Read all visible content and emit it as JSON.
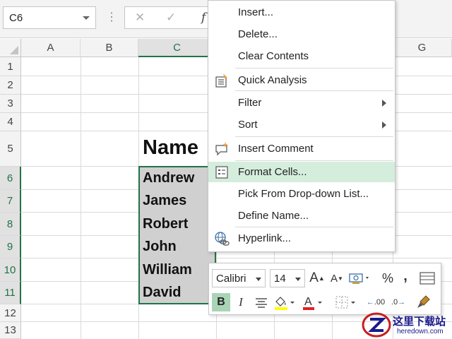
{
  "name_box": {
    "value": "C6"
  },
  "formula_bar": {
    "cancel_icon": "✕",
    "enter_icon": "✓",
    "fx_label": "f"
  },
  "columns": [
    "A",
    "B",
    "C",
    "G"
  ],
  "rows": [
    "1",
    "2",
    "3",
    "4",
    "5",
    "6",
    "7",
    "8",
    "9",
    "10",
    "11",
    "12",
    "13"
  ],
  "cells": {
    "header": "Name",
    "names": [
      "Andrew",
      "James",
      "Robert",
      "John",
      "William",
      "David"
    ]
  },
  "context_menu": {
    "items": [
      {
        "label": "Insert..."
      },
      {
        "label": "Delete..."
      },
      {
        "label": "Clear Contents"
      },
      {
        "label": "Quick Analysis"
      },
      {
        "label": "Filter"
      },
      {
        "label": "Sort"
      },
      {
        "label": "Insert Comment"
      },
      {
        "label": "Format Cells..."
      },
      {
        "label": "Pick From Drop-down List..."
      },
      {
        "label": "Define Name..."
      },
      {
        "label": "Hyperlink..."
      }
    ]
  },
  "mini_toolbar": {
    "font": "Calibri",
    "size": "14",
    "grow_label": "A",
    "shrink_label": "A",
    "percent_label": "%",
    "comma_label": ",",
    "bold_label": "B",
    "italic_label": "I",
    "decimal_increase_label": ".00",
    "decimal_decrease_label": ".0"
  },
  "watermark": {
    "line1": "这里下载站",
    "line2": "heredown.com"
  },
  "colors": {
    "accent": "#217346",
    "highlight": "#d5eddd",
    "selection": "#d0d0d0"
  }
}
